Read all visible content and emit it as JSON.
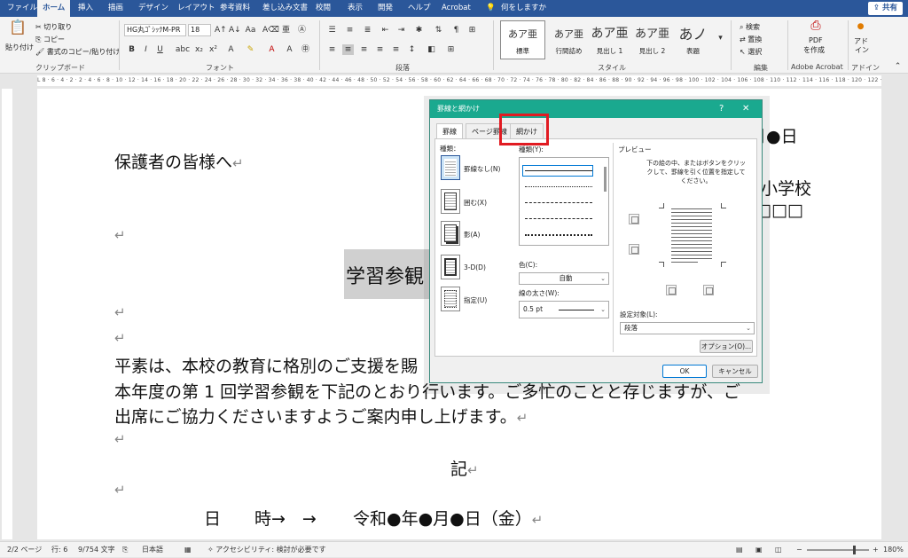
{
  "menu": {
    "tabs": [
      "ファイル",
      "ホーム",
      "挿入",
      "描画",
      "デザイン",
      "レイアウト",
      "参考資料",
      "差し込み文書",
      "校閲",
      "表示",
      "開発",
      "ヘルプ",
      "Acrobat"
    ],
    "active_tab": "ホーム",
    "search_placeholder": "何をしますか",
    "share_label": "共有"
  },
  "ribbon": {
    "clipboard": {
      "paste": "貼り付け",
      "cut": "切り取り",
      "copy": "コピー",
      "format_painter": "書式のコピー/貼り付け",
      "label": "クリップボード"
    },
    "font": {
      "font_name": "HG丸ｺﾞｼｯｸM-PR",
      "font_size": "18",
      "label": "フォント"
    },
    "paragraph": {
      "label": "段落"
    },
    "styles": {
      "items": [
        {
          "sample": "あア亜",
          "name": "標準"
        },
        {
          "sample": "あア亜",
          "name": "行間詰め"
        },
        {
          "sample": "あア亜",
          "name": "見出し 1"
        },
        {
          "sample": "あア亜",
          "name": "見出し 2"
        },
        {
          "sample": "あノ",
          "name": "表題"
        }
      ],
      "label": "スタイル"
    },
    "editing": {
      "find": "検索",
      "replace": "置換",
      "select": "選択",
      "label": "編集"
    },
    "acrobat": {
      "pdf": "PDF",
      "create": "を作成",
      "label": "Adobe Acrobat"
    },
    "addin": {
      "line1": "アド",
      "line2": "イン",
      "label": "アドイン"
    }
  },
  "ruler_text": "L  8 · 6 · 4 · 2 · 2 · 4 · 6 · 8 · 10 · 12 · 14 · 16 · 18 · 20 · 22 · 24 · 26 · 28 · 30 · 32 · 34 · 36 · 38 · 40 · 42 · 44 · 46 · 48 · 50 · 52 · 54 · 56 · 58 · 60 · 62 · 64 · 66 · 68 · 70 · 72 · 74 · 76 · 78 · 80 · 82 · 84 · 86 · 88 · 90 · 92 · 94 · 96 · 98 · 100 · 102 · 104 · 106 · 108 · 110 · 112 · 114 · 116 · 118 · 120 · 122 · 124 · 126 · 128 · 130 · 132 · 134 · 136 · 138 · 140 · 142 · 144 · 146 · 148 · 150 · 152 · 154 · 156 · 158 · 160 · 162 · 164 · 166 · 168 · 170 · 172 · 174 · 176 · 178",
  "document": {
    "date_tail": "月●日",
    "greeting": "保護者の皆様へ",
    "school_tail": "小学校",
    "boxes_tail": "□□□",
    "title_visible": "学習参観",
    "para1_line1": "平素は、本校の教育に格別のご支援を賜",
    "para1_line2": "本年度の第 1 回学習参観を下記のとおり行います。ご多忙のことと存じますが、ご",
    "para1_line3": "出席にご協力くださいますようご案内申し上げます。",
    "ki": "記",
    "date_line_label": "日　　時→　→",
    "date_line_value": "令和●年●月●日（金）",
    "para_mark": "↵"
  },
  "dialog": {
    "title": "罫線と網かけ",
    "help": "?",
    "close": "✕",
    "tabs": [
      "罫線",
      "ページ罫線",
      "網かけ"
    ],
    "active_tab": "罫線",
    "type_label": "種類：",
    "settings": [
      {
        "label": "罫線なし(N)"
      },
      {
        "label": "囲む(X)"
      },
      {
        "label": "影(A)"
      },
      {
        "label": "3-D(D)"
      },
      {
        "label": "指定(U)"
      }
    ],
    "style_label": "種類(Y):",
    "color_label": "色(C):",
    "color_value": "自動",
    "width_label": "線の太さ(W):",
    "width_value": "0.5 pt",
    "preview_label": "プレビュー",
    "preview_hint": "下の絵の中、またはボタンをクリックして、罫線を引く位置を指定してください。",
    "apply_label": "設定対象(L):",
    "apply_value": "段落",
    "options_button": "オプション(O)...",
    "ok_button": "OK",
    "cancel_button": "キャンセル"
  },
  "status": {
    "page": "2/2 ページ",
    "line": "行: 6",
    "words": "9/754 文字",
    "lang": "日本語",
    "accessibility": "アクセシビリティ: 検討が必要です",
    "zoom": "180%"
  },
  "colors": {
    "word_blue": "#2b579a",
    "dialog_title": "#1aa98f",
    "highlight": "#e11b22"
  }
}
